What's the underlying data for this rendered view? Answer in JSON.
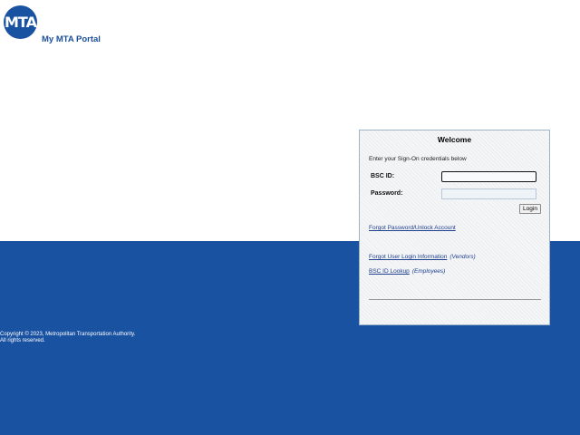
{
  "header": {
    "logo_text": "MTA",
    "portal_title": "My MTA Portal"
  },
  "footer": {
    "copyright_line1": "Copyright © 2023, Metropolitan Transportation Authority.",
    "copyright_line2": "All rights reserved."
  },
  "login_panel": {
    "title": "Welcome",
    "instructions": "Enter your Sign-On credentials below",
    "bsc_id_label": "BSC ID:",
    "bsc_id_value": "",
    "password_label": "Password:",
    "password_value": "",
    "login_button": "Login",
    "forgot_password_link": "Forgot Password/Unlock Account",
    "forgot_user_link": "Forgot User Login Information",
    "forgot_user_note": "(Vendors)",
    "bsc_lookup_link": "BSC ID Lookup",
    "bsc_lookup_note": "(Employees)"
  },
  "colors": {
    "brand_blue": "#1a52a2",
    "link_blue": "#1f3f8f"
  }
}
